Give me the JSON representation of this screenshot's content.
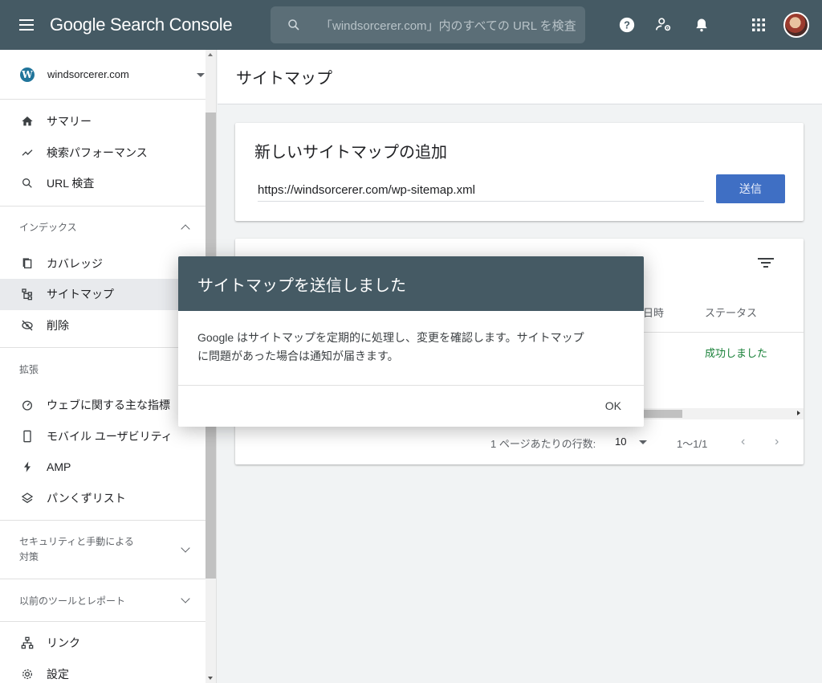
{
  "app": {
    "title": "Google Search Console",
    "search_placeholder": "「windsorcerer.com」内のすべての URL を検査"
  },
  "topbar_icons": [
    "menu-icon",
    "search-icon",
    "help-icon",
    "manage-users-icon",
    "notifications-icon",
    "apps-icon",
    "avatar"
  ],
  "sidebar": {
    "property": "windsorcerer.com",
    "primary": [
      {
        "icon": "home-icon",
        "label": "サマリー"
      },
      {
        "icon": "trending-icon",
        "label": "検索パフォーマンス"
      },
      {
        "icon": "search-icon",
        "label": "URL 検査"
      }
    ],
    "index_section": {
      "label": "インデックス",
      "items": [
        {
          "icon": "coverage-icon",
          "label": "カバレッジ"
        },
        {
          "icon": "sitemap-icon",
          "label": "サイトマップ"
        },
        {
          "icon": "removals-icon",
          "label": "削除"
        }
      ]
    },
    "enhancements_section": {
      "label": "拡張",
      "items": [
        {
          "icon": "speed-icon",
          "label": "ウェブに関する主な指標"
        },
        {
          "icon": "mobile-icon",
          "label": "モバイル ユーザビリティ"
        },
        {
          "icon": "amp-icon",
          "label": "AMP"
        },
        {
          "icon": "breadcrumb-icon",
          "label": "パンくずリスト"
        }
      ]
    },
    "security_section": {
      "label_line1": "セキュリティと手動による",
      "label_line2": "対策"
    },
    "legacy_section": {
      "label": "以前のツールとレポート"
    },
    "bottom": [
      {
        "icon": "links-icon",
        "label": "リンク"
      },
      {
        "icon": "settings-icon",
        "label": "設定"
      }
    ]
  },
  "main": {
    "page_title": "サイトマップ",
    "add_card": {
      "title": "新しいサイトマップの追加",
      "url_value": "https://windsorcerer.com/wp-sitemap.xml",
      "submit_label": "送信"
    },
    "table_card": {
      "col_date_partial": "日時",
      "col_status": "ステータス",
      "row_status": "成功しました",
      "rows_per_page_label": "1 ページあたりの行数:",
      "rows_per_page_value": "10",
      "range": "1〜1/1"
    }
  },
  "dialog": {
    "title": "サイトマップを送信しました",
    "body_line1": "Google はサイトマップを定期的に処理し、変更を確認します。サイトマップ",
    "body_line2": "に問題があった場合は通知が届きます。",
    "ok_label": "OK"
  },
  "colors": {
    "topbar": "#455a64",
    "primary_button": "#3f6fc4",
    "success": "#188038"
  }
}
